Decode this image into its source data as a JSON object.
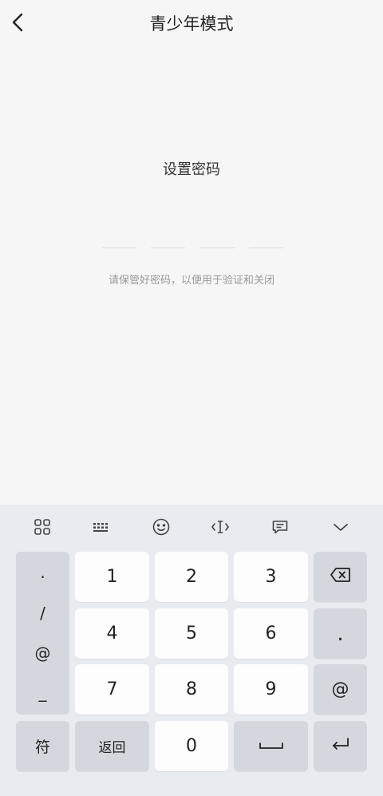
{
  "header": {
    "title": "青少年模式",
    "back_icon": "chevron-left-icon"
  },
  "main": {
    "heading": "设置密码",
    "hint": "请保管好密码，以便用于验证和关闭",
    "pin_length": 4
  },
  "keyboard": {
    "toolbar": [
      {
        "name": "apps-grid-icon"
      },
      {
        "name": "keyboard-icon"
      },
      {
        "name": "emoji-icon"
      },
      {
        "name": "cursor-move-icon"
      },
      {
        "name": "clipboard-icon"
      },
      {
        "name": "collapse-keyboard-icon"
      }
    ],
    "symbols": [
      ".",
      "/",
      "@",
      "_"
    ],
    "digits": [
      "1",
      "2",
      "3",
      "4",
      "5",
      "6",
      "7",
      "8",
      "9"
    ],
    "zero": "0",
    "right_keys": {
      "dot": ".",
      "at": "@"
    },
    "bottom": {
      "symbol_label": "符",
      "return_label": "返回"
    }
  }
}
